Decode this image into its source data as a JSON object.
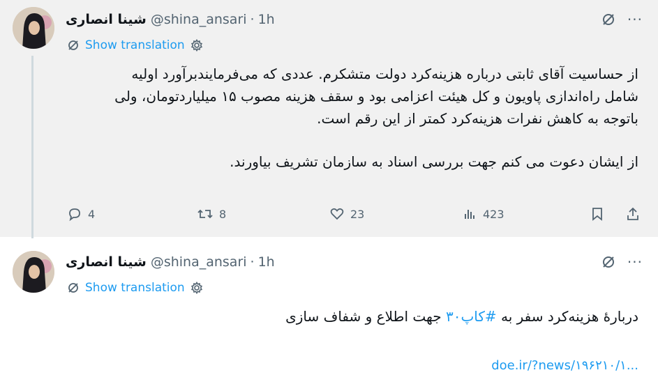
{
  "tweet1": {
    "author_name": "شینا انصاری",
    "handle": "@shina_ansari",
    "separator": "·",
    "time": "1h",
    "more_label": "···",
    "translation_label": "Show translation",
    "text_lines": [
      "از حساسیت آقای ثابتی درباره هزینه‌کرد دولت متشکرم. عددی که می‌فرمایندبرآورد اولیه",
      "شامل راه‌اندازی پاویون و کل هیئت اعزامی بود و سقف هزینه مصوب ۱۵ میلیاردتومان، ولی",
      "باتوجه به کاهش نفرات هزینه‌کرد کمتر از این رقم است.",
      "از ایشان دعوت می کنم جهت بررسی اسناد به سازمان تشریف بیاورند."
    ],
    "replies": "4",
    "retweets": "8",
    "likes": "23",
    "views": "423"
  },
  "tweet2": {
    "author_name": "شینا انصاری",
    "handle": "@shina_ansari",
    "separator": "·",
    "time": "1h",
    "more_label": "···",
    "translation_label": "Show translation",
    "text_before": "دربارهٔ هزینه‌کرد سفر به ",
    "hashtag": "#کاپ۳۰",
    "text_after": " جهت اطلاع و شفاف سازی",
    "link": "doe.ir/?news/۱۹۶۲۱۰/۱..."
  },
  "icons": {
    "grok": "slash-circle-icon",
    "translate": "globe-slash-icon",
    "settings": "gear-icon",
    "reply": "speech-bubble-icon",
    "retweet": "retweet-icon",
    "like": "heart-icon",
    "views": "bar-chart-icon",
    "bookmark": "bookmark-icon",
    "share": "share-icon"
  },
  "colors": {
    "accent": "#1d9bf0",
    "muted": "#536471",
    "text": "#0f1419",
    "highlight_bg": "#f1f1f1"
  }
}
